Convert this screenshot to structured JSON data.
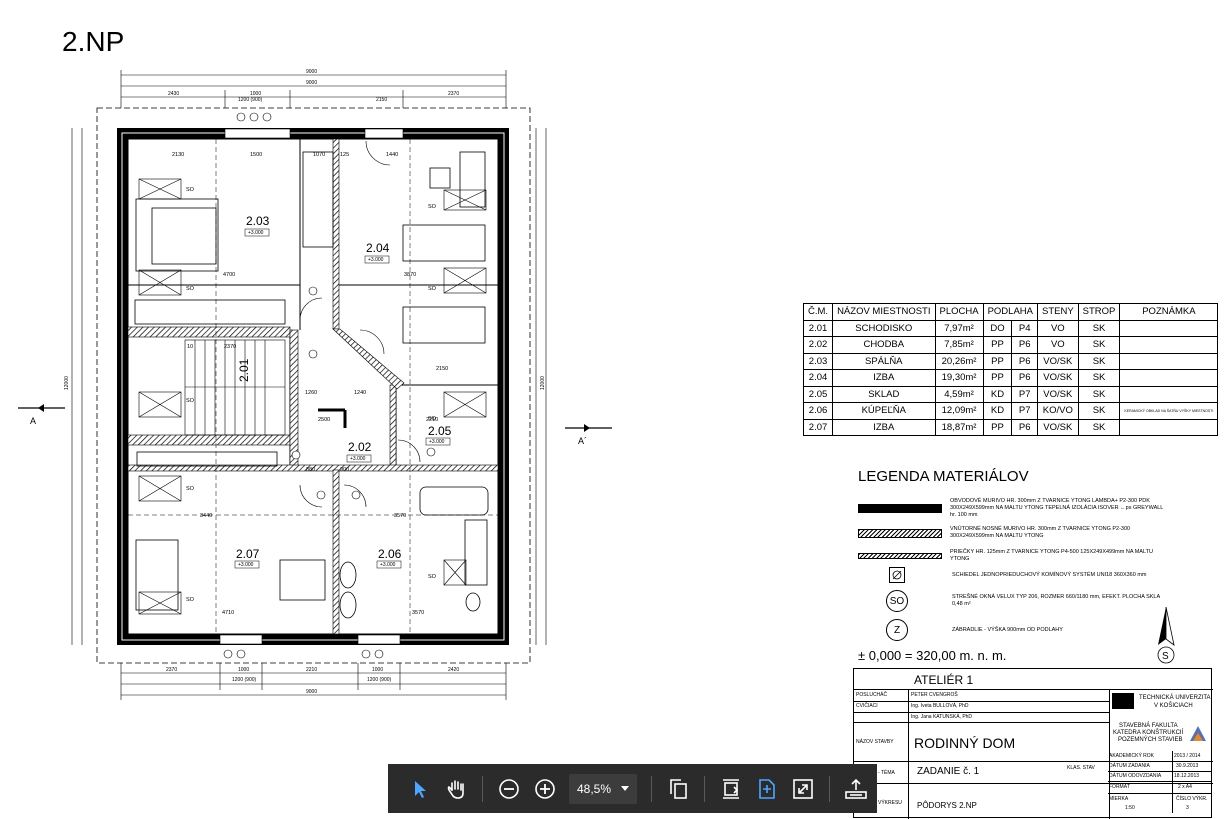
{
  "page_title": "2.NP",
  "plan": {
    "overall_width_dims": [
      "9000",
      "9000"
    ],
    "top_dims": [
      "2430",
      "1000",
      "1200 (900)",
      "2150",
      "2370"
    ],
    "bottom_dims": [
      "2370",
      "1000",
      "1200 (900)",
      "2210",
      "1000",
      "1200 (900)",
      "2420"
    ],
    "bottom_total": "9000",
    "side_dims_left": "12000",
    "side_dims_right": "12000",
    "section_left": "A",
    "section_right": "A´",
    "rooms": [
      {
        "num": "2.03",
        "level": "+3.000"
      },
      {
        "num": "2.04",
        "level": "+3.000"
      },
      {
        "num": "2.01",
        "level": ""
      },
      {
        "num": "2.02",
        "level": "+3.000"
      },
      {
        "num": "2.05",
        "level": "+3.000"
      },
      {
        "num": "2.07",
        "level": "+3.000"
      },
      {
        "num": "2.06",
        "level": "+3.000"
      }
    ],
    "so_label": "SO",
    "inner_dims": [
      "2130",
      "1500",
      "1070",
      "125",
      "1440",
      "4700",
      "3870",
      "1260",
      "1240",
      "2150",
      "2500",
      "2210",
      "3440",
      "3570",
      "4710",
      "3570",
      "880",
      "900",
      "10",
      "2370"
    ]
  },
  "room_table": {
    "headers": [
      "Č.M.",
      "NÁZOV MIESTNOSTI",
      "PLOCHA",
      "PODLAHA",
      "STENY",
      "STROP",
      "POZNÁMKA"
    ],
    "rows": [
      {
        "cm": "2.01",
        "name": "SCHODISKO",
        "area": "7,97m²",
        "floor": "DO",
        "floor2": "P4",
        "walls": "VO",
        "ceiling": "SK",
        "note": ""
      },
      {
        "cm": "2.02",
        "name": "CHODBA",
        "area": "7,85m²",
        "floor": "PP",
        "floor2": "P6",
        "walls": "VO",
        "ceiling": "SK",
        "note": ""
      },
      {
        "cm": "2.03",
        "name": "SPÁLŇA",
        "area": "20,26m²",
        "floor": "PP",
        "floor2": "P6",
        "walls": "VO/SK",
        "ceiling": "SK",
        "note": ""
      },
      {
        "cm": "2.04",
        "name": "IZBA",
        "area": "19,30m²",
        "floor": "PP",
        "floor2": "P6",
        "walls": "VO/SK",
        "ceiling": "SK",
        "note": ""
      },
      {
        "cm": "2.05",
        "name": "SKLAD",
        "area": "4,59m²",
        "floor": "KD",
        "floor2": "P7",
        "walls": "VO/SK",
        "ceiling": "SK",
        "note": ""
      },
      {
        "cm": "2.06",
        "name": "KÚPEĽŇA",
        "area": "12,09m²",
        "floor": "KD",
        "floor2": "P7",
        "walls": "KO/VO",
        "ceiling": "SK",
        "note": "KERAMICKÝ OBKLAD NA ŠATŇU VYŠKY MIESTNOSTI"
      },
      {
        "cm": "2.07",
        "name": "IZBA",
        "area": "18,87m²",
        "floor": "PP",
        "floor2": "P6",
        "walls": "VO/SK",
        "ceiling": "SK",
        "note": ""
      }
    ]
  },
  "legend": {
    "title": "LEGENDA MATERIÁLOV",
    "items": [
      {
        "symbol": "solid",
        "text": "OBVODOVÉ MURIVO HR. 300mm Z TVARNICE YTONG LAMBDA+ P2-300 PDK 300X249X599mm NA MALTU YTONG TEPELNÁ IZOLÁCIA ISOVER ←ps GREYWALL hr. 100 mm"
      },
      {
        "symbol": "hatch",
        "text": "VNÚTORNÉ NOSNÉ MURIVO HR. 300mm Z TVARNICE YTONG P2-300 300X249X599mm NA MALTU YTONG"
      },
      {
        "symbol": "hatch",
        "text": "PRIEČKY HR. 125mm Z TVARNICE YTONG P4-500 125X249X499mm NA MALTU YTONG"
      },
      {
        "symbol": "chimney",
        "text": "SCHIEDEL JEDNOPRIEDUCHOVÝ KOMÍNOVÝ SYSTÉM UNI18 360X360 mm"
      },
      {
        "symbol": "SO",
        "text": "STREŠNÉ OKNÁ VELUX TYP 206, ROZMER 660/1180 mm, EFEKT. PLOCHA SKLA 0,48 m²"
      },
      {
        "symbol": "Z",
        "text": "ZÁBRADLIE - VÝŠKA 900mm OD PODLAHY"
      }
    ],
    "elevation": "± 0,000 = 320,00 m. n. m."
  },
  "title_block": {
    "atelier": "ATELIÉR 1",
    "poslucach_label": "POSLUCHÁČ",
    "poslucach": "PETER CVENGROŠ",
    "cviciaci_label": "CVIČIACI",
    "cviciaci_1": "Ing. Iveta BULLOVÁ, PhD",
    "cviciaci_2": "Ing. Jana KATUNSKÁ, PhD",
    "nazov_label": "NÁZOV STAVBY",
    "nazov": "RODINNÝ DOM",
    "tema_label": "- TÉMA",
    "zadanie": "ZADANIE č. 1",
    "klas_stav": "KLAS. STAV",
    "vykres_label": "VÝKRESU",
    "vykres": "PÔDORYS 2.NP",
    "univ_1": "TECHNICKÁ UNIVERZITA",
    "univ_2": "V KOŠICIACH",
    "fac_1": "STAVEBNÁ FAKULTA",
    "fac_2": "KATEDRA KONŠTRUKCIÍ",
    "fac_3": "POZEMNÝCH STAVIEB",
    "akad_rok_label": "AKADEMICKÝ ROK",
    "akad_rok": "2013 / 2014",
    "datum_zadania_label": "DÁTUM ZADANIA",
    "datum_zadania": "30.9.2013",
    "datum_odovzdania_label": "DÁTUM ODOVZDANIA",
    "datum_odovzdania": "18.12.2013",
    "format_label": "FORMÁT",
    "format": "2 x A4",
    "mierka_label": "MIERKA",
    "mierka": "1:50",
    "cislo_label": "ČÍSLO VÝKR.",
    "cislo": "3"
  },
  "north_label": "S",
  "toolbar": {
    "zoom": "48,5%",
    "icons": [
      "select-arrow-icon",
      "hand-pan-icon",
      "zoom-out-icon",
      "zoom-in-icon",
      "copy-pages-icon",
      "fit-height-icon",
      "fit-page-icon",
      "fullscreen-icon",
      "download-tray-icon"
    ],
    "accent": "#4ea6ff"
  }
}
